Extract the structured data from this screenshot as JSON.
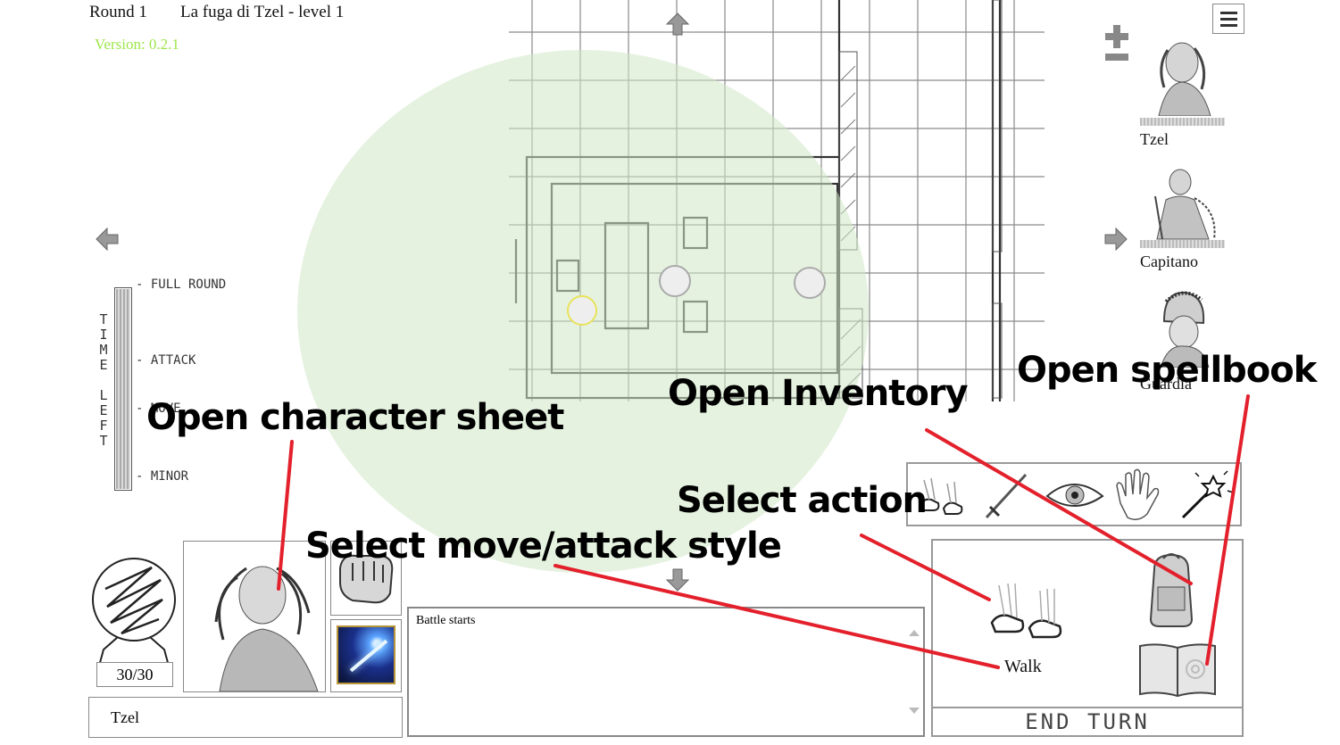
{
  "header": {
    "round": "Round 1",
    "title": "La fuga di Tzel - level 1",
    "version": "Version: 0.2.1"
  },
  "time_meter": {
    "vertical_label": [
      "T",
      "I",
      "M",
      "E",
      "",
      "L",
      "E",
      "F",
      "T"
    ],
    "marks": [
      "FULL ROUND",
      "ATTACK",
      "MOVE",
      "MINOR"
    ],
    "fill_fraction": 1.0
  },
  "initiative": [
    {
      "name": "Tzel",
      "health_fraction": 1.0
    },
    {
      "name": "Capitano",
      "health_fraction": 1.0
    },
    {
      "name": "Guardia",
      "health_fraction": 1.0
    }
  ],
  "player": {
    "hp": "30/30",
    "name": "Tzel"
  },
  "log": {
    "entries": [
      "Battle starts"
    ]
  },
  "action": {
    "selected_label": "Walk",
    "end_turn": "END TURN",
    "options": [
      "walk-icon",
      "sword-icon",
      "eye-icon",
      "hand-icon",
      "magic-wand-icon"
    ]
  },
  "annotations": {
    "character_sheet": "Open character sheet",
    "move_attack_style": "Select move/attack style",
    "select_action": "Select action",
    "inventory": "Open Inventory",
    "spellbook": "Open spellbook"
  },
  "colors": {
    "annotation_arrow": "#e3202b",
    "range_circle": "#e7f2e3",
    "version": "#9de64a"
  }
}
